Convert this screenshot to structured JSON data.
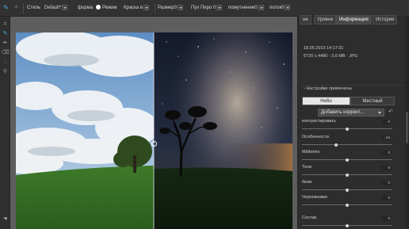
{
  "toolbar": {
    "style_label": "Стиль",
    "style_value": "Default*",
    "form_label": "форма",
    "mode_label": "Режим",
    "mode_value": "Краска в",
    "size_label": "Размер",
    "size_value": "0",
    "fluff_label": "Пух Перо",
    "fluff_value": "0",
    "darken_label": "помутнение",
    "darken_value": "0",
    "flow_label": "поток",
    "flow_value": "0"
  },
  "tabs": [
    {
      "label": "не"
    },
    {
      "label": "Уровни"
    },
    {
      "label": "Информация"
    },
    {
      "label": "История"
    }
  ],
  "info": {
    "date": "18.05.2019 14:17:31",
    "details": "6720 x 4480 - 3,6 MB - JPG"
  },
  "applied_settings": "Настройки применены",
  "segment": {
    "left": "Небо",
    "right": "Местный"
  },
  "add_correction": "Добавить коррект...",
  "sliders": [
    {
      "label": "контрастировать",
      "value": "0",
      "level": 0.5
    },
    {
      "label": "Особенности",
      "value": "-24",
      "level": 0.38
    },
    {
      "label": "Midtones",
      "value": "0",
      "level": 0.5
    },
    {
      "label": "Тени",
      "value": "0",
      "level": 0.5
    },
    {
      "label": "бели",
      "value": "0",
      "level": 0.5
    },
    {
      "label": "Черножожие",
      "value": "0",
      "level": 0.5
    },
    {
      "label": "Состав",
      "value": "0",
      "level": 0.5
    }
  ],
  "icons": {
    "tool_brush": "brush-icon",
    "tool_move": "move-icon",
    "tool_crop": "crop-icon",
    "tool_eraser": "eraser-icon",
    "tool_zoom": "zoom-icon",
    "split_handle": "split-handle-icon"
  },
  "colors": {
    "accent": "#4ab3e8",
    "panel": "#2d2d2d",
    "canvas": "#5e5e5e"
  }
}
